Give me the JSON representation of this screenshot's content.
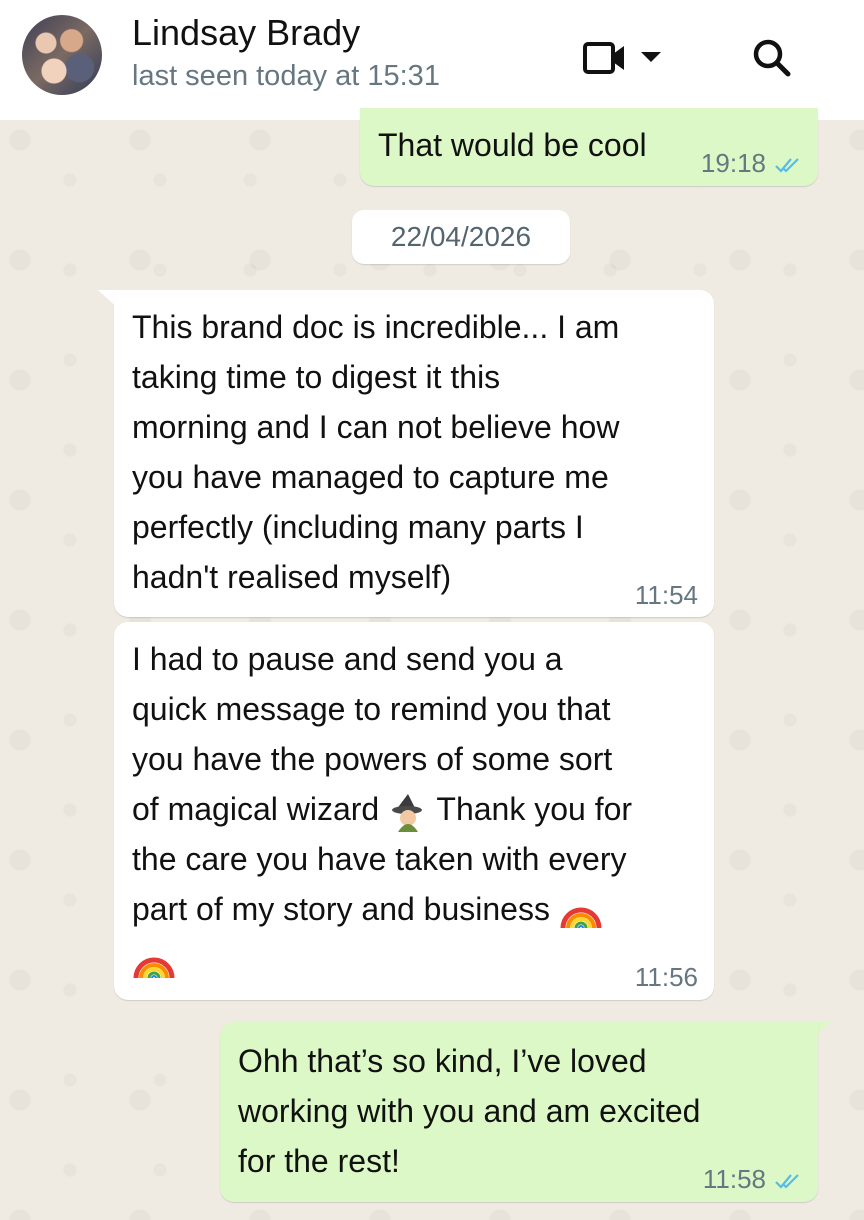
{
  "header": {
    "contact_name": "Lindsay Brady",
    "status": "last seen today at 15:31"
  },
  "messages": [
    {
      "direction": "outgoing",
      "text": "That would be cool",
      "time": "19:18",
      "read": true
    },
    {
      "direction": "incoming",
      "text": "This brand doc is incredible... I am\ntaking time to digest it this\nmorning and I can not believe how\nyou have managed to capture me\nperfectly (including many parts I\nhadn't realised myself)",
      "time": "11:54"
    },
    {
      "direction": "incoming",
      "text_lines": [
        "I had to pause and send you a",
        "quick message to remind you that",
        "you have the powers of some sort",
        "of magical wizard",
        "Thank you for",
        "the care you have taken with every",
        "part of my story and business"
      ],
      "time": "11:56",
      "emojis": [
        "wizard-emoji",
        "rainbow-emoji",
        "rainbow-emoji"
      ]
    },
    {
      "direction": "outgoing",
      "text": "Ohh that’s so kind, I’ve loved\nworking with you and am excited\nfor the rest!",
      "time": "11:58",
      "read": true
    }
  ],
  "date_separator": "22/04/2026",
  "colors": {
    "outgoing_bubble": "#dcf8c6",
    "incoming_bubble": "#ffffff",
    "read_ticks": "#53bdeb",
    "chat_background": "#efeae2"
  },
  "icons": [
    "video-call-icon",
    "chevron-down-icon",
    "search-icon",
    "double-check-icon"
  ]
}
